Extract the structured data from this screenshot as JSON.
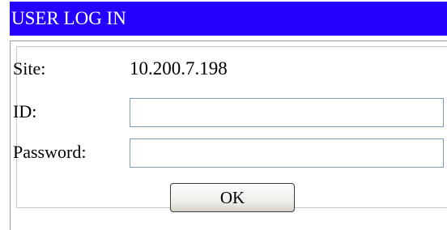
{
  "title": "USER LOG IN",
  "form": {
    "site_label": "Site:",
    "site_value": "10.200.7.198",
    "id_label": "ID:",
    "id_value": "",
    "password_label": "Password:",
    "password_value": "",
    "ok_label": "OK"
  },
  "colors": {
    "title_bar": "#2400ff",
    "title_text": "#ffffff"
  }
}
